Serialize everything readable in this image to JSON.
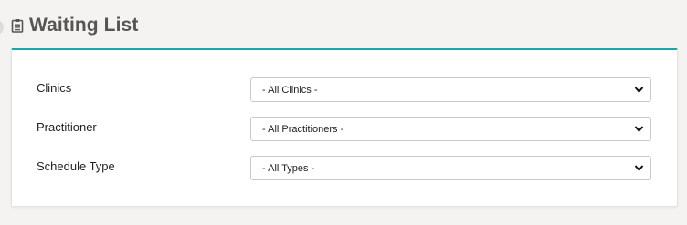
{
  "header": {
    "title": "Waiting List",
    "icon": "clipboard-icon"
  },
  "colors": {
    "accent": "#19a8a5",
    "background": "#f4f3f1",
    "title": "#555555"
  },
  "form": {
    "clinics": {
      "label": "Clinics",
      "value": "- All Clinics -"
    },
    "practitioner": {
      "label": "Practitioner",
      "value": "- All Practitioners -"
    },
    "schedule_type": {
      "label": "Schedule Type",
      "value": "- All Types -"
    }
  }
}
